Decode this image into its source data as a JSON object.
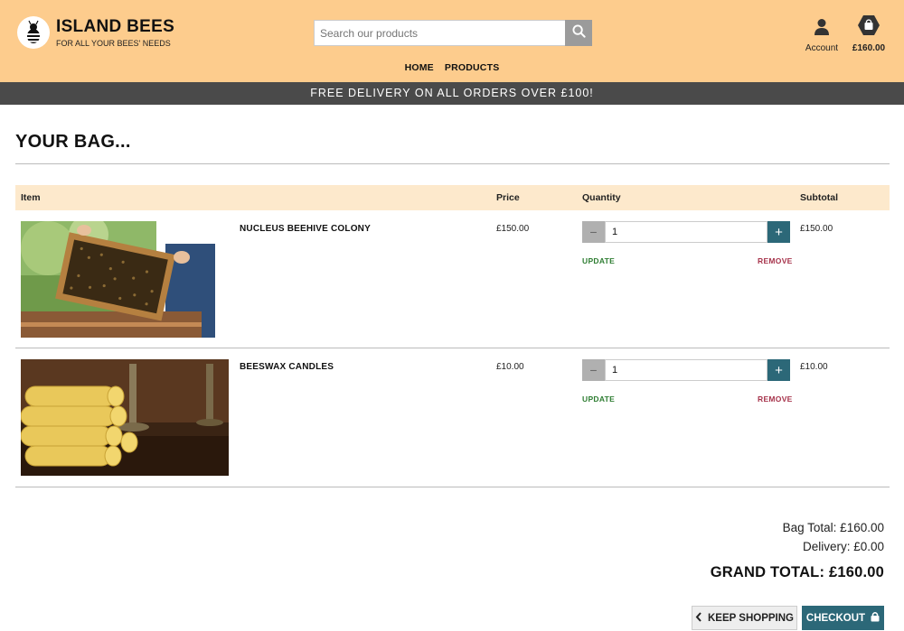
{
  "brand": {
    "title": "ISLAND BEES",
    "tagline": "FOR ALL YOUR BEES' NEEDS"
  },
  "search": {
    "placeholder": "Search our products",
    "icon": "search-icon"
  },
  "account": {
    "label": "Account",
    "icon": "user-icon"
  },
  "bag": {
    "total": "£160.00",
    "icon": "shopping-bag-icon"
  },
  "nav": {
    "home": "HOME",
    "products": "PRODUCTS"
  },
  "banner": {
    "text": "FREE DELIVERY ON ALL ORDERS OVER £100!"
  },
  "page": {
    "title": "YOUR BAG..."
  },
  "table": {
    "headers": {
      "item": "Item",
      "price": "Price",
      "quantity": "Quantity",
      "subtotal": "Subtotal"
    },
    "rows": [
      {
        "name": "NUCLEUS BEEHIVE COLONY",
        "price": "£150.00",
        "quantity": "1",
        "subtotal": "£150.00",
        "update": "UPDATE",
        "remove": "REMOVE",
        "image": "beekeeper-frame-photo"
      },
      {
        "name": "BEESWAX CANDLES",
        "price": "£10.00",
        "quantity": "1",
        "subtotal": "£10.00",
        "update": "UPDATE",
        "remove": "REMOVE",
        "image": "beeswax-candles-photo"
      }
    ]
  },
  "totals": {
    "bag_total": "Bag Total: £160.00",
    "delivery": "Delivery: £0.00",
    "grand_total": "GRAND TOTAL: £160.00"
  },
  "buttons": {
    "keep_shopping": "KEEP SHOPPING",
    "checkout": "CHECKOUT"
  },
  "colors": {
    "header_bg": "#fdcc8d",
    "banner_bg": "#4a4a4a",
    "table_header_bg": "#fde9cc",
    "accent": "#2c6878",
    "update": "#2e7d32",
    "remove": "#a6324a"
  }
}
